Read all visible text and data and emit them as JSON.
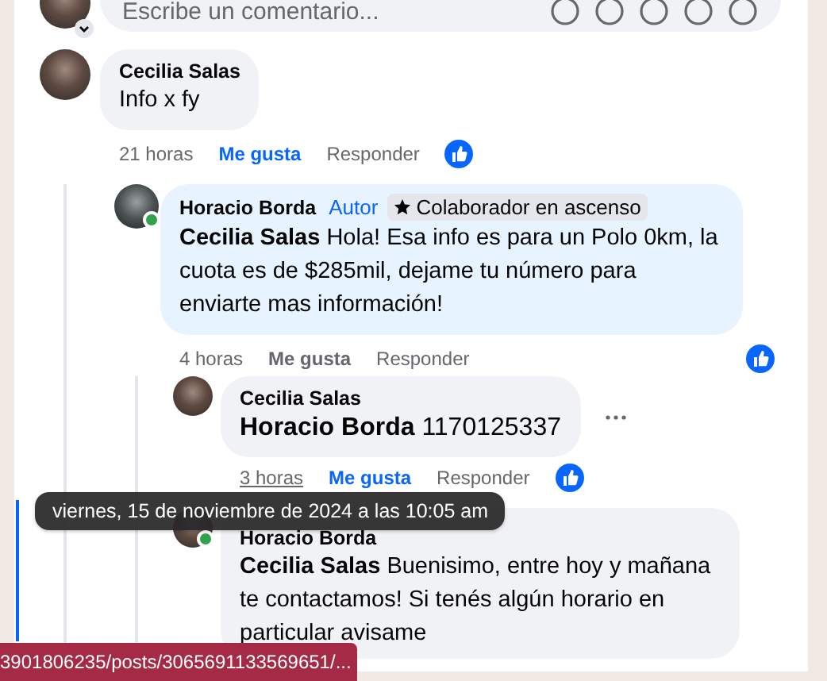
{
  "composer": {
    "placeholder": "Escribe un comentario..."
  },
  "comments": [
    {
      "author": "Cecilia Salas",
      "text": "Info x fy",
      "online": false,
      "highlighted": false,
      "time": "21 horas",
      "time_hovered": false,
      "like_label": "Me gusta",
      "liked": true,
      "reply_label": "Responder",
      "reactions": true,
      "menu": false,
      "children": [
        {
          "author": "Horacio Borda",
          "author_label": "Autor",
          "badge": "Colaborador en ascenso",
          "text": "**Cecilia Salas** Hola! Esa info es para un Polo 0km, la cuota es de $285mil, dejame tu número para enviarte mas información!",
          "online": true,
          "highlighted": true,
          "time": "4 horas",
          "time_hovered": false,
          "like_label": "Me gusta",
          "liked": false,
          "reply_label": "Responder",
          "reactions": true,
          "menu": false,
          "children": [
            {
              "author": "Cecilia Salas",
              "text": "**Horacio Borda** 1170125337",
              "online": false,
              "highlighted": false,
              "time": "3 horas",
              "time_hovered": true,
              "like_label": "Me gusta",
              "liked": true,
              "reply_label": "Responder",
              "reactions": true,
              "menu": true,
              "large_text": true
            },
            {
              "author": "Horacio Borda",
              "text": "**Cecilia Salas** Buenisimo, entre hoy y mañana te contactamos! Si tenés algún horario en particular avisame",
              "online": true,
              "highlighted": false,
              "menu": false
            }
          ]
        }
      ]
    }
  ],
  "tooltip": "viernes, 15 de noviembre de 2024 a las 10:05 am",
  "status_url": "3901806235/posts/3065691133569651/..."
}
